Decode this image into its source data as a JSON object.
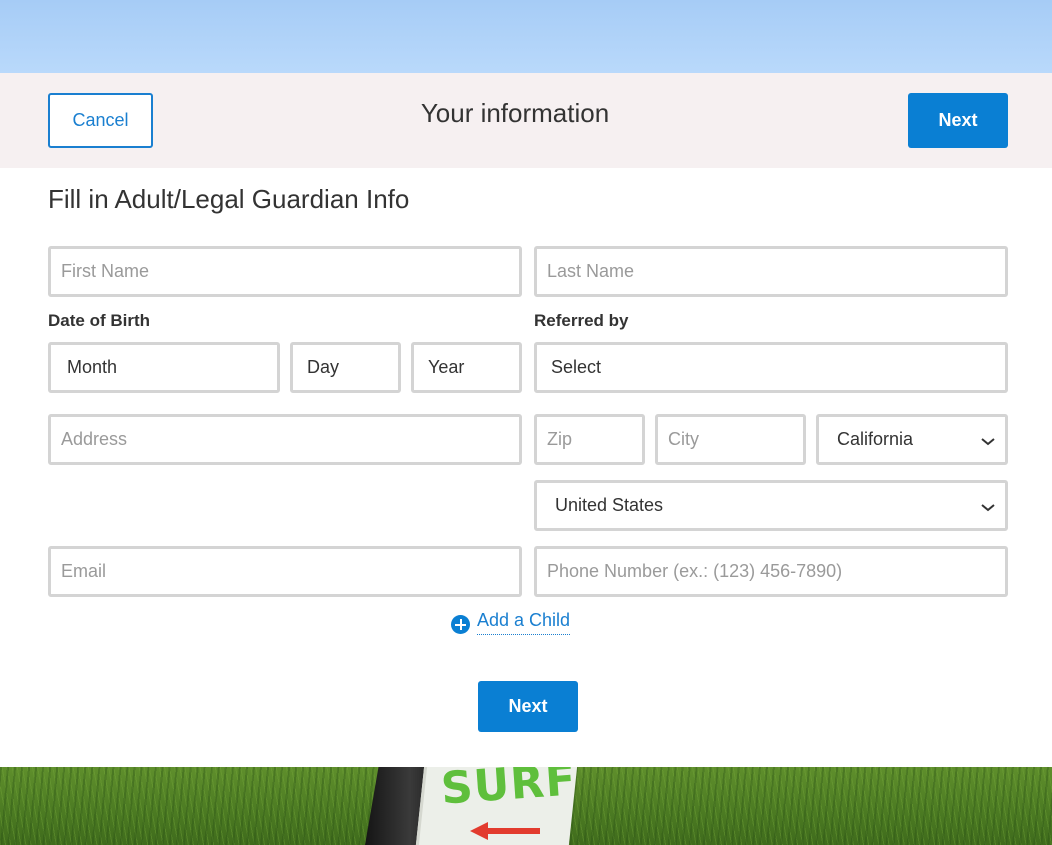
{
  "header": {
    "cancel_label": "Cancel",
    "title": "Your information",
    "next_label": "Next"
  },
  "form": {
    "section_title": "Fill in Adult/Legal Guardian Info",
    "first_name": {
      "placeholder": "First Name",
      "value": ""
    },
    "last_name": {
      "placeholder": "Last Name",
      "value": ""
    },
    "dob": {
      "label": "Date of Birth",
      "month": "Month",
      "day": "Day",
      "year": "Year"
    },
    "referred_by": {
      "label": "Referred by",
      "selected": "Select"
    },
    "address": {
      "placeholder": "Address",
      "value": ""
    },
    "zip": {
      "placeholder": "Zip",
      "value": ""
    },
    "city": {
      "placeholder": "City",
      "value": ""
    },
    "state": {
      "selected": "California"
    },
    "country": {
      "selected": "United States"
    },
    "email": {
      "placeholder": "Email",
      "value": ""
    },
    "phone": {
      "placeholder": "Phone Number (ex.: (123) 456-7890)",
      "value": ""
    },
    "add_child_label": "Add a Child",
    "next_label": "Next"
  },
  "background": {
    "sign_text": "SURF"
  },
  "colors": {
    "accent": "#0a7fd3",
    "header_bg": "#f6f0f1",
    "field_border": "#d4d4d4"
  }
}
